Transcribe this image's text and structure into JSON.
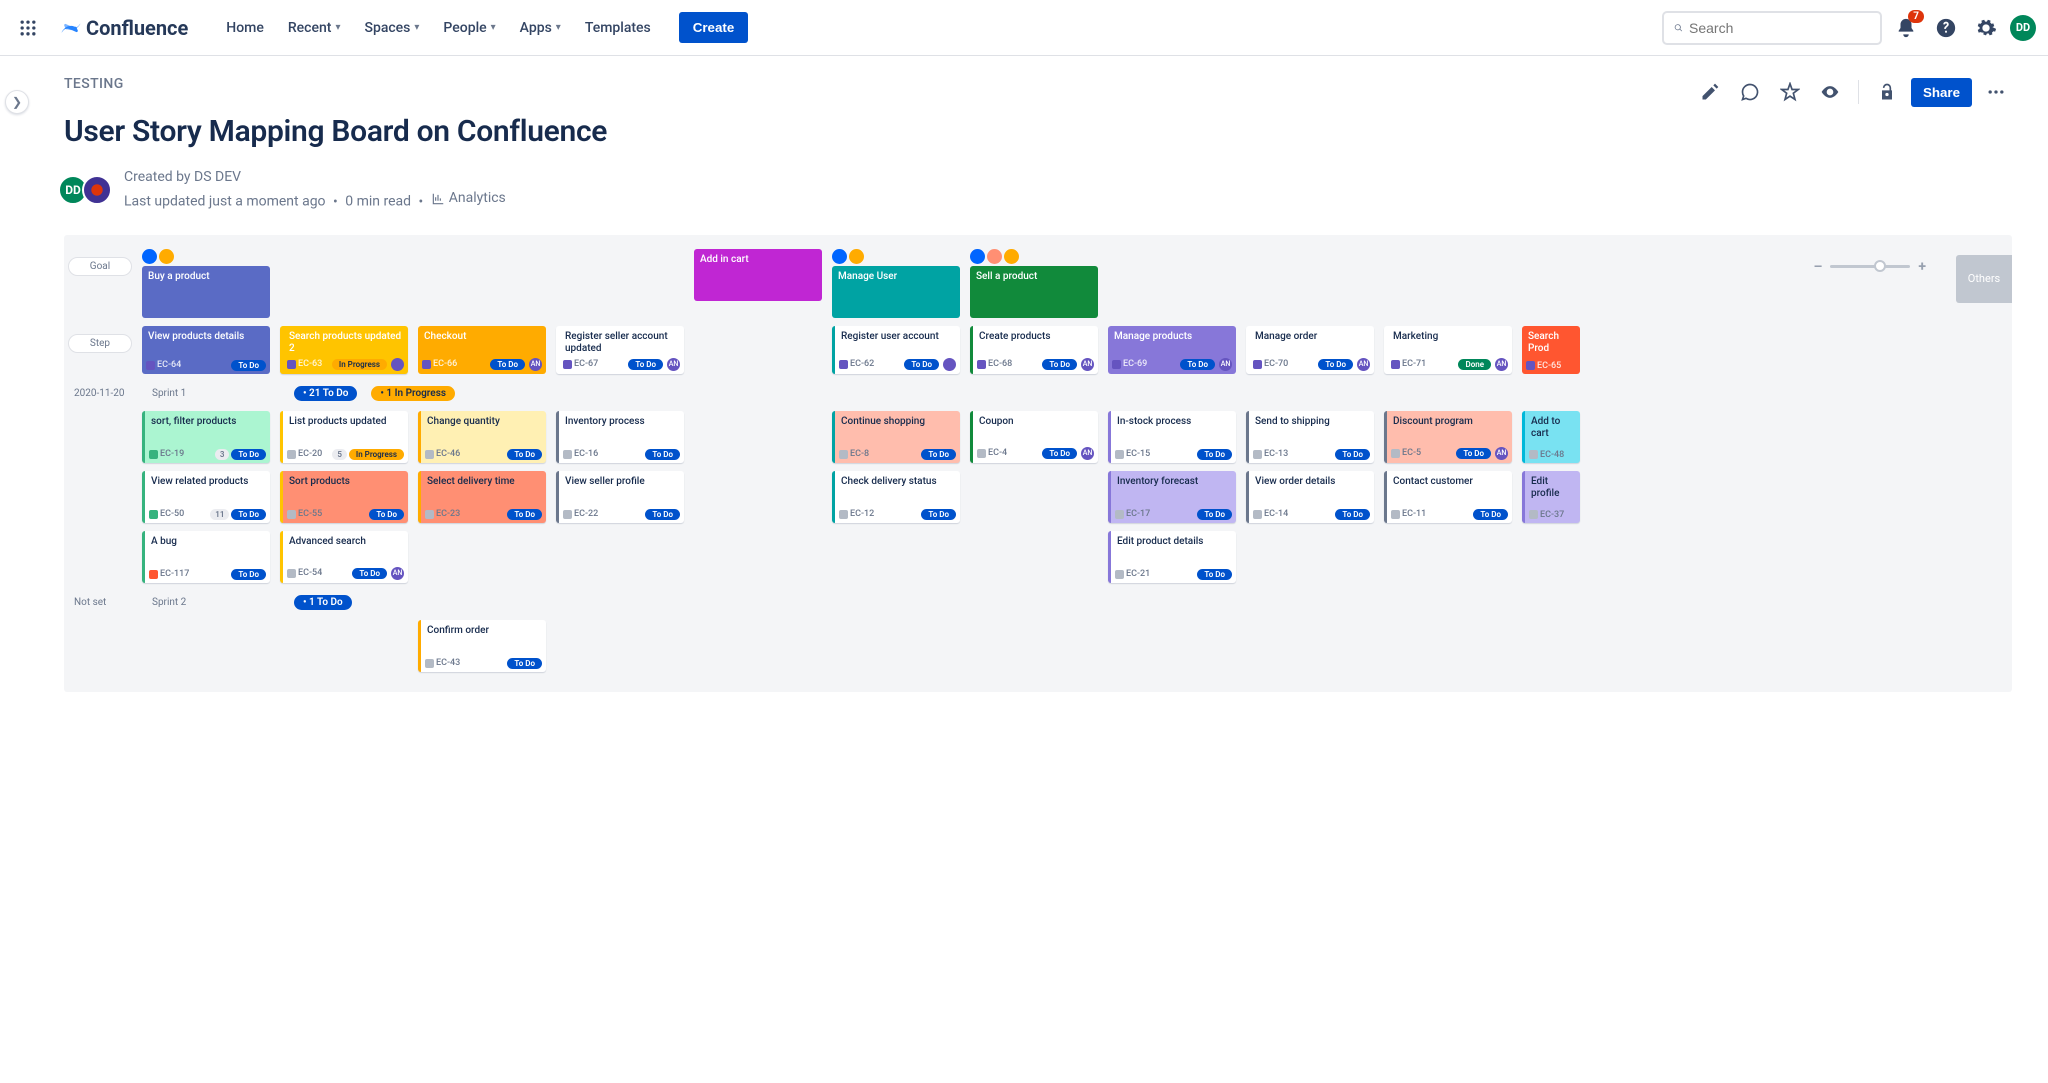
{
  "nav": {
    "product": "Confluence",
    "links": [
      "Home",
      "Recent",
      "Spaces",
      "People",
      "Apps",
      "Templates"
    ],
    "dropdown_indices": [
      1,
      2,
      3,
      4
    ],
    "create": "Create",
    "search_placeholder": "Search",
    "notifications": "7",
    "avatar": "DD"
  },
  "page": {
    "breadcrumb": "TESTING",
    "title": "User Story Mapping Board on Confluence",
    "created_by_label": "Created by ",
    "author": "DS DEV",
    "updated": "Last updated just a moment ago",
    "read_time": "0 min read",
    "analytics": "Analytics",
    "share": "Share",
    "byline_avatar": "DD"
  },
  "board": {
    "lane_goal_label": "Goal",
    "lane_step_label": "Step",
    "more_col": "Others",
    "goals": [
      {
        "title": "Buy a product",
        "col": 0,
        "color": "#5a6bc5",
        "personas": [
          "gear",
          "y"
        ]
      },
      {
        "title": "Add in cart",
        "col": 4,
        "color": "#c026d3",
        "personas": []
      },
      {
        "title": "Manage User",
        "col": 5,
        "color": "#00a3a3",
        "personas": [
          "gear",
          "y"
        ]
      },
      {
        "title": "Sell a product",
        "col": 6,
        "color": "#118a3b",
        "personas": [
          "gear",
          "p",
          "y"
        ]
      }
    ],
    "steps": [
      {
        "title": "View products details",
        "key": "EC-64",
        "status": "To Do",
        "color": "#5a6bc5",
        "itype": "epic",
        "assignee": null
      },
      {
        "title": "Search products updated 2",
        "key": "EC-63",
        "status": "In Progress",
        "color": "#ffc400",
        "border": true,
        "itype": "epic",
        "assignee": "av"
      },
      {
        "title": "Checkout",
        "key": "EC-66",
        "status": "To Do",
        "color": "#ffab00",
        "itype": "epic",
        "assignee": "AN"
      },
      {
        "title": "Register seller account updated",
        "key": "EC-67",
        "status": "To Do",
        "color": "#fff",
        "border": true,
        "itype": "epic",
        "assignee": "AN"
      },
      null,
      {
        "title": "Register user account",
        "key": "EC-62",
        "status": "To Do",
        "color": "#fff",
        "border": true,
        "edge": "#00a3a3",
        "itype": "epic",
        "assignee": "av"
      },
      {
        "title": "Create products",
        "key": "EC-68",
        "status": "To Do",
        "color": "#fff",
        "border": true,
        "edge": "#118a3b",
        "itype": "epic",
        "assignee": "AN"
      },
      {
        "title": "Manage products",
        "key": "EC-69",
        "status": "To Do",
        "color": "#8777d9",
        "itype": "epic",
        "assignee": "AN"
      },
      {
        "title": "Manage order",
        "key": "EC-70",
        "status": "To Do",
        "color": "#fff",
        "border": true,
        "itype": "epic",
        "assignee": "AN"
      },
      {
        "title": "Marketing",
        "key": "EC-71",
        "status": "Done",
        "color": "#fff",
        "border": true,
        "itype": "epic",
        "assignee": "AN"
      },
      {
        "title": "Search Prod",
        "key": "EC-65",
        "status": "",
        "color": "#ff5630",
        "itype": "epic",
        "cut": true
      }
    ],
    "sprints": [
      {
        "date": "2020-11-20",
        "name": "Sprint 1",
        "pills": [
          {
            "t": "21 To Do",
            "k": "todo"
          },
          {
            "t": "1 In Progress",
            "k": "inprog"
          }
        ],
        "rows": [
          [
            {
              "title": "sort, filter products",
              "key": "EC-19",
              "status": "To Do",
              "edge": "#36b37e",
              "bg": "#abf5d1",
              "itype": "story",
              "count": "3"
            },
            {
              "title": "List products updated",
              "key": "EC-20",
              "status": "In Progress",
              "edge": "#ffc400",
              "itype": "sub",
              "count": "5"
            },
            {
              "title": "Change quantity",
              "key": "EC-46",
              "status": "To Do",
              "edge": "#ffab00",
              "bg": "#fff0b3",
              "itype": "sub"
            },
            {
              "title": "Inventory process",
              "key": "EC-16",
              "status": "To Do",
              "edge": "#6b778c",
              "itype": "sub"
            },
            null,
            {
              "title": "Continue shopping",
              "key": "EC-8",
              "status": "To Do",
              "edge": "#00a3a3",
              "bg": "#ffbdad",
              "itype": "sub"
            },
            {
              "title": "Coupon",
              "key": "EC-4",
              "status": "To Do",
              "edge": "#118a3b",
              "itype": "sub",
              "assignee": "AN"
            },
            {
              "title": "In-stock process",
              "key": "EC-15",
              "status": "To Do",
              "edge": "#8777d9",
              "itype": "sub"
            },
            {
              "title": "Send to shipping",
              "key": "EC-13",
              "status": "To Do",
              "edge": "#6b778c",
              "itype": "sub"
            },
            {
              "title": "Discount program",
              "key": "EC-5",
              "status": "To Do",
              "edge": "#6b778c",
              "bg": "#ffbdad",
              "itype": "sub",
              "assignee": "AN"
            },
            {
              "title": "Add to cart",
              "key": "EC-48",
              "status": "",
              "edge": "#00b8d9",
              "bg": "#79e2f2",
              "itype": "sub",
              "cut": true
            }
          ],
          [
            {
              "title": "View related products",
              "key": "EC-50",
              "status": "To Do",
              "edge": "#36b37e",
              "itype": "story",
              "count": "11"
            },
            {
              "title": "Sort products",
              "key": "EC-55",
              "status": "To Do",
              "edge": "#ffc400",
              "bg": "#ff8f73",
              "itype": "sub"
            },
            {
              "title": "Select delivery time",
              "key": "EC-23",
              "status": "To Do",
              "edge": "#ffab00",
              "bg": "#ff8f73",
              "itype": "sub"
            },
            {
              "title": "View seller profile",
              "key": "EC-22",
              "status": "To Do",
              "edge": "#6b778c",
              "itype": "sub"
            },
            null,
            {
              "title": "Check delivery status",
              "key": "EC-12",
              "status": "To Do",
              "edge": "#00a3a3",
              "itype": "sub"
            },
            null,
            {
              "title": "Inventory forecast",
              "key": "EC-17",
              "status": "To Do",
              "edge": "#8777d9",
              "bg": "#c0b6f2",
              "itype": "sub"
            },
            {
              "title": "View order details",
              "key": "EC-14",
              "status": "To Do",
              "edge": "#6b778c",
              "itype": "sub"
            },
            {
              "title": "Contact customer",
              "key": "EC-11",
              "status": "To Do",
              "edge": "#6b778c",
              "itype": "sub"
            },
            {
              "title": "Edit profile",
              "key": "EC-37",
              "status": "",
              "edge": "#8777d9",
              "bg": "#c0b6f2",
              "itype": "sub",
              "cut": true
            }
          ],
          [
            {
              "title": "A bug",
              "key": "EC-117",
              "status": "To Do",
              "edge": "#36b37e",
              "itype": "bug"
            },
            {
              "title": "Advanced search",
              "key": "EC-54",
              "status": "To Do",
              "edge": "#ffc400",
              "itype": "sub",
              "assignee": "AN"
            },
            null,
            null,
            null,
            null,
            null,
            {
              "title": "Edit product details",
              "key": "EC-21",
              "status": "To Do",
              "edge": "#8777d9",
              "itype": "sub"
            },
            null,
            null,
            null
          ]
        ]
      },
      {
        "date": "Not set",
        "name": "Sprint 2",
        "pills": [
          {
            "t": "1 To Do",
            "k": "todo"
          }
        ],
        "rows": [
          [
            null,
            null,
            {
              "title": "Confirm order",
              "key": "EC-43",
              "status": "To Do",
              "edge": "#ffab00",
              "itype": "sub"
            },
            null,
            null,
            null,
            null,
            null,
            null,
            null,
            null
          ]
        ]
      }
    ]
  }
}
